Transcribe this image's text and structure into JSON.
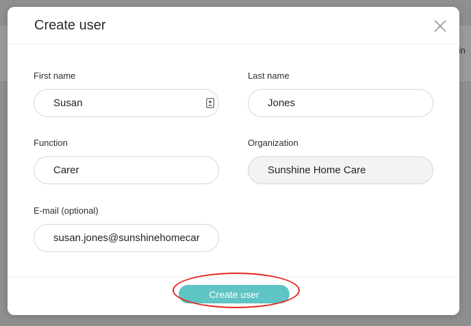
{
  "background": {
    "partial_text": "llin"
  },
  "dialog": {
    "title": "Create user",
    "close_icon": "close-icon",
    "fields": {
      "first_name": {
        "label": "First name",
        "value": "Susan",
        "icon": "contact-card-icon"
      },
      "last_name": {
        "label": "Last name",
        "value": "Jones"
      },
      "function": {
        "label": "Function",
        "value": "Carer"
      },
      "organization": {
        "label": "Organization",
        "value": "Sunshine Home Care"
      },
      "email": {
        "label": "E-mail (optional)",
        "value": "susan.jones@sunshinehomecare."
      }
    },
    "submit_label": "Create user",
    "colors": {
      "accent": "#5fc4c4",
      "highlight": "#e8231f"
    }
  }
}
